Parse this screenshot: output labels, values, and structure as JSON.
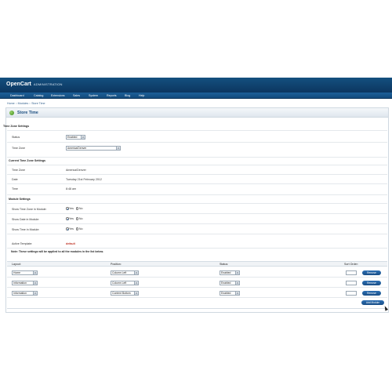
{
  "header": {
    "logo_main": "OpenCart",
    "logo_sub": "ADMINISTRATION"
  },
  "menu": [
    "Dashboard",
    "Catalog",
    "Extensions",
    "Sales",
    "System",
    "Reports",
    "Blog",
    "Help"
  ],
  "breadcrumb": "Home :: Modules :: Store Time",
  "box": {
    "title": "Store Time"
  },
  "time_zone_settings": {
    "heading": "Time Zone Settings",
    "status_label": "Status",
    "status_value": "Enabled",
    "timezone_label": "Time Zone",
    "timezone_value": "America/Denver"
  },
  "current_settings": {
    "heading": "Current Time Zone Settings",
    "tz_label": "Time Zone",
    "tz_value": "America/Denver",
    "date_label": "Date",
    "date_value": "Tuesday 21st February 2012",
    "time_label": "Time",
    "time_value": "8:48 am"
  },
  "module_settings": {
    "heading": "Module Settings",
    "rows": [
      {
        "label": "Show Time Zone in Module:",
        "yes": "Yes",
        "no": "No"
      },
      {
        "label": "Show Date in Module:",
        "yes": "Yes",
        "no": "No"
      },
      {
        "label": "Show Time in Module:",
        "yes": "Yes",
        "no": "No"
      }
    ],
    "active_template_label": "Active Template:",
    "active_template_value": "default",
    "note": "Note: These settings will be applied to all the modules in the list below."
  },
  "table": {
    "headers": {
      "layout": "Layout:",
      "position": "Position:",
      "status": "Status:",
      "sort": "Sort Order:"
    },
    "rows": [
      {
        "layout": "Home",
        "position": "Column Left",
        "status": "Enabled",
        "remove": "Remove"
      },
      {
        "layout": "Information",
        "position": "Column Left",
        "status": "Enabled",
        "remove": "Remove"
      },
      {
        "layout": "Information",
        "position": "Content Bottom",
        "status": "Enabled",
        "remove": "Remove"
      }
    ],
    "add_button": "Add Module"
  }
}
